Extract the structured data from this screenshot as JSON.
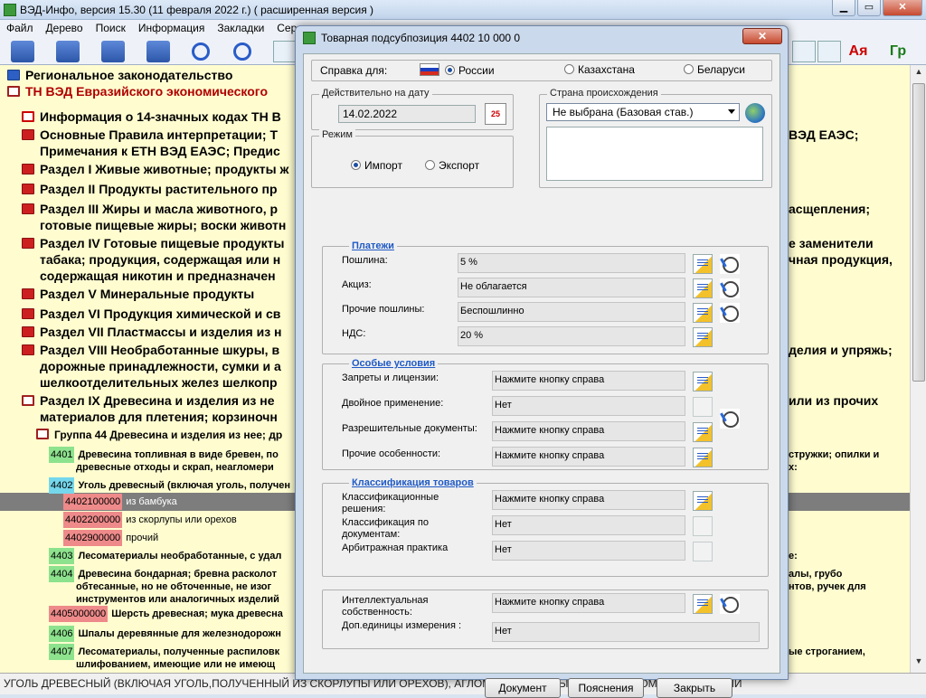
{
  "app": {
    "title": "ВЭД-Инфо, версия 15.30 (11 февраля 2022 г.)  ( расширенная версия )",
    "win_min": "▁",
    "win_max": "▭",
    "win_close": "✕"
  },
  "menu": [
    "Файл",
    "Дерево",
    "Поиск",
    "Информация",
    "Закладки",
    "Сер"
  ],
  "toolbar": {
    "r_label": "Ая",
    "g_label": "Гр"
  },
  "tree": {
    "rows": [
      {
        "text": "Региональное законодательство",
        "icon": "blue-book-icon"
      },
      {
        "text": "ТН ВЭД Евразийского экономического",
        "icon": "open-book-icon",
        "color": "#b00000"
      },
      {
        "text": "Информация о 14-значных кодах ТН В",
        "icon": "info-icon"
      },
      {
        "text": "Основные Правила интерпретации; Т",
        "tail": "ВЭД ЕАЭС;",
        "icon": "red-book-icon"
      },
      {
        "text": "Примечания к ЕТН ВЭД ЕАЭС; Предис",
        "icon": ""
      },
      {
        "text": "Раздел I Живые животные; продукты ж",
        "icon": "red-book-icon"
      },
      {
        "text": "Раздел II Продукты растительного пр",
        "icon": "red-book-icon"
      },
      {
        "text": "Раздел III Жиры и масла животного, р",
        "tail": "асщепления;",
        "icon": "red-book-icon"
      },
      {
        "text": "готовые пищевые жиры; воски животн",
        "icon": ""
      },
      {
        "text": "Раздел IV Готовые пищевые продукты",
        "tail": "е заменители",
        "icon": "red-book-icon"
      },
      {
        "text": "табака; продукция, содержащая или н",
        "tail": "чная продукция,",
        "icon": ""
      },
      {
        "text": "содержащая никотин и предназначен",
        "icon": ""
      },
      {
        "text": "Раздел V Минеральные продукты",
        "icon": "red-book-icon"
      },
      {
        "text": "Раздел VI Продукция химической и св",
        "icon": "red-book-icon"
      },
      {
        "text": "Раздел VII Пластмассы и изделия из н",
        "icon": "red-book-icon"
      },
      {
        "text": "Раздел VIII Необработанные шкуры, в",
        "tail": "делия и упряжь;",
        "icon": "red-book-icon"
      },
      {
        "text": "дорожные принадлежности, сумки и а",
        "icon": ""
      },
      {
        "text": "шелкоотделительных желез шелкопр",
        "icon": ""
      },
      {
        "text": "Раздел IX Древесина и изделия из не",
        "tail": "или из прочих",
        "icon": "open-book-icon"
      },
      {
        "text": "материалов для плетения; корзиночн",
        "icon": ""
      },
      {
        "text": "Группа 44 Древесина и изделия из нее; др",
        "icon": "open-book-icon"
      }
    ],
    "codes": [
      {
        "code": "4401",
        "cls": "c-green",
        "text": "Древесина топливная в виде бревен, по",
        "tail": "стружки; опилки и",
        "line2": "древесные отходы и скрап, неагломери",
        "tail2": "х:"
      },
      {
        "code": "4402",
        "cls": "c-cyan",
        "text": "Уголь древесный (включая уголь, получен"
      },
      {
        "code": "4402100000",
        "cls": "c-red",
        "text": "из бамбука"
      },
      {
        "code": "4402200000",
        "cls": "c-red",
        "text": "из скорлупы или орехов"
      },
      {
        "code": "4402900000",
        "cls": "c-red",
        "text": "прочий"
      },
      {
        "code": "4403",
        "cls": "c-green",
        "text": "Лесоматериалы необработанные, с удал",
        "tail": "е:"
      },
      {
        "code": "4404",
        "cls": "c-green",
        "text": "Древесина бондарная; бревна расколот",
        "tail": "алы, грубо",
        "line2": "обтесанные, но не обточенные, не изог",
        "tail2": "нтов, ручек для",
        "line3": "инструментов или аналогичных изделий"
      },
      {
        "code": "4405000000",
        "cls": "c-red",
        "text": "Шерсть древесная; мука древесна"
      },
      {
        "code": "4406",
        "cls": "c-green",
        "text": "Шпалы деревянные для железнодорожн"
      },
      {
        "code": "4407",
        "cls": "c-green",
        "text": "Лесоматериалы, полученные распиловк",
        "tail": "ые строганием,",
        "line2": "шлифованием, имеющие или не имеющ"
      }
    ]
  },
  "status": "УГОЛЬ ДРЕВЕСНЫЙ (ВКЛЮЧАЯ УГОЛЬ,ПОЛУЧЕННЫЙ ИЗ СКОРЛУПЫ ИЛИ ОРЕХОВ), АГЛОМЕРИРОВАННЫЙ ИЛИ НЕАГЛОМЕРИРОВАННЫЙ",
  "dialog": {
    "title": "Товарная подсубпозиция 4402 10 000 0",
    "close": "✕",
    "ref_label": "Справка для:",
    "countries": [
      {
        "name": "России",
        "selected": true
      },
      {
        "name": "Казахстана",
        "selected": false
      },
      {
        "name": "Беларуси",
        "selected": false
      }
    ],
    "date_caption": "Действительно на дату",
    "date_value": "14.02.2022",
    "calendar": "25",
    "origin_caption": "Страна происхождения",
    "origin_value": "Не выбрана (Базовая став.)",
    "mode_caption": "Режим",
    "mode_import": "Импорт",
    "mode_export": "Экспорт",
    "payments_title": "Платежи",
    "payments": [
      {
        "label": "Пошлина:",
        "value": "5 %",
        "hist": true
      },
      {
        "label": "Акциз:",
        "value": "Не облагается",
        "hist": true
      },
      {
        "label": "Прочие пошлины:",
        "value": "Беспошлинно",
        "hist": true
      },
      {
        "label": "НДС:",
        "value": "20 %",
        "hist": false
      }
    ],
    "special_title": "Особые условия",
    "special": [
      {
        "label": "Запреты и лицензии:",
        "value": "Нажмите кнопку справа"
      },
      {
        "label": "Двойное применение:",
        "value": "Нет"
      },
      {
        "label": "Разрешительные документы:",
        "value": "Нажмите кнопку справа"
      },
      {
        "label": "Прочие особенности:",
        "value": "Нажмите кнопку справа"
      }
    ],
    "classif_title": "Классификация товаров",
    "classif": [
      {
        "label": "Классификационные решения:",
        "value": "Нажмите кнопку справа"
      },
      {
        "label": "Классификация по документам:",
        "value": "Нет"
      },
      {
        "label": "Арбитражная практика",
        "value": "Нет"
      }
    ],
    "ip_label": "Интеллектуальная собственность:",
    "ip_value": "Нажмите кнопку справа",
    "units_label": "Доп.единицы измерения :",
    "units_value": "Нет",
    "btn_document": "Документ",
    "btn_notes": "Пояснения",
    "btn_close": "Закрыть"
  }
}
